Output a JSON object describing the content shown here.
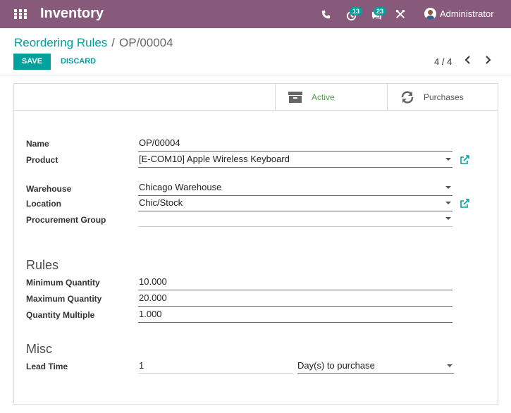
{
  "navbar": {
    "app_title": "Inventory",
    "activity_count": "13",
    "message_count": "23",
    "user_name": "Administrator",
    "bg_color": "#875a7b"
  },
  "breadcrumb": {
    "parent": "Reordering Rules",
    "separator": "/",
    "current": "OP/00004"
  },
  "toolbar": {
    "save_label": "SAVE",
    "discard_label": "DISCARD"
  },
  "pager": {
    "value": "4 / 4"
  },
  "button_box": {
    "active_label": "Active",
    "purchases_label": "Purchases",
    "active_color": "#4d9e4d"
  },
  "form": {
    "name": {
      "label": "Name",
      "value": "OP/00004"
    },
    "product": {
      "label": "Product",
      "value": "[E-COM10] Apple Wireless Keyboard"
    },
    "warehouse": {
      "label": "Warehouse",
      "value": "Chicago Warehouse"
    },
    "location": {
      "label": "Location",
      "value": "Chic/Stock"
    },
    "procurement_group": {
      "label": "Procurement Group",
      "value": ""
    }
  },
  "rules": {
    "title": "Rules",
    "min_qty": {
      "label": "Minimum Quantity",
      "value": "10.000"
    },
    "max_qty": {
      "label": "Maximum Quantity",
      "value": "20.000"
    },
    "qty_multiple": {
      "label": "Quantity Multiple",
      "value": "1.000"
    }
  },
  "misc": {
    "title": "Misc",
    "lead_time": {
      "label": "Lead Time",
      "value": "1",
      "unit": "Day(s) to purchase"
    }
  },
  "accent_color": "#00a09d"
}
